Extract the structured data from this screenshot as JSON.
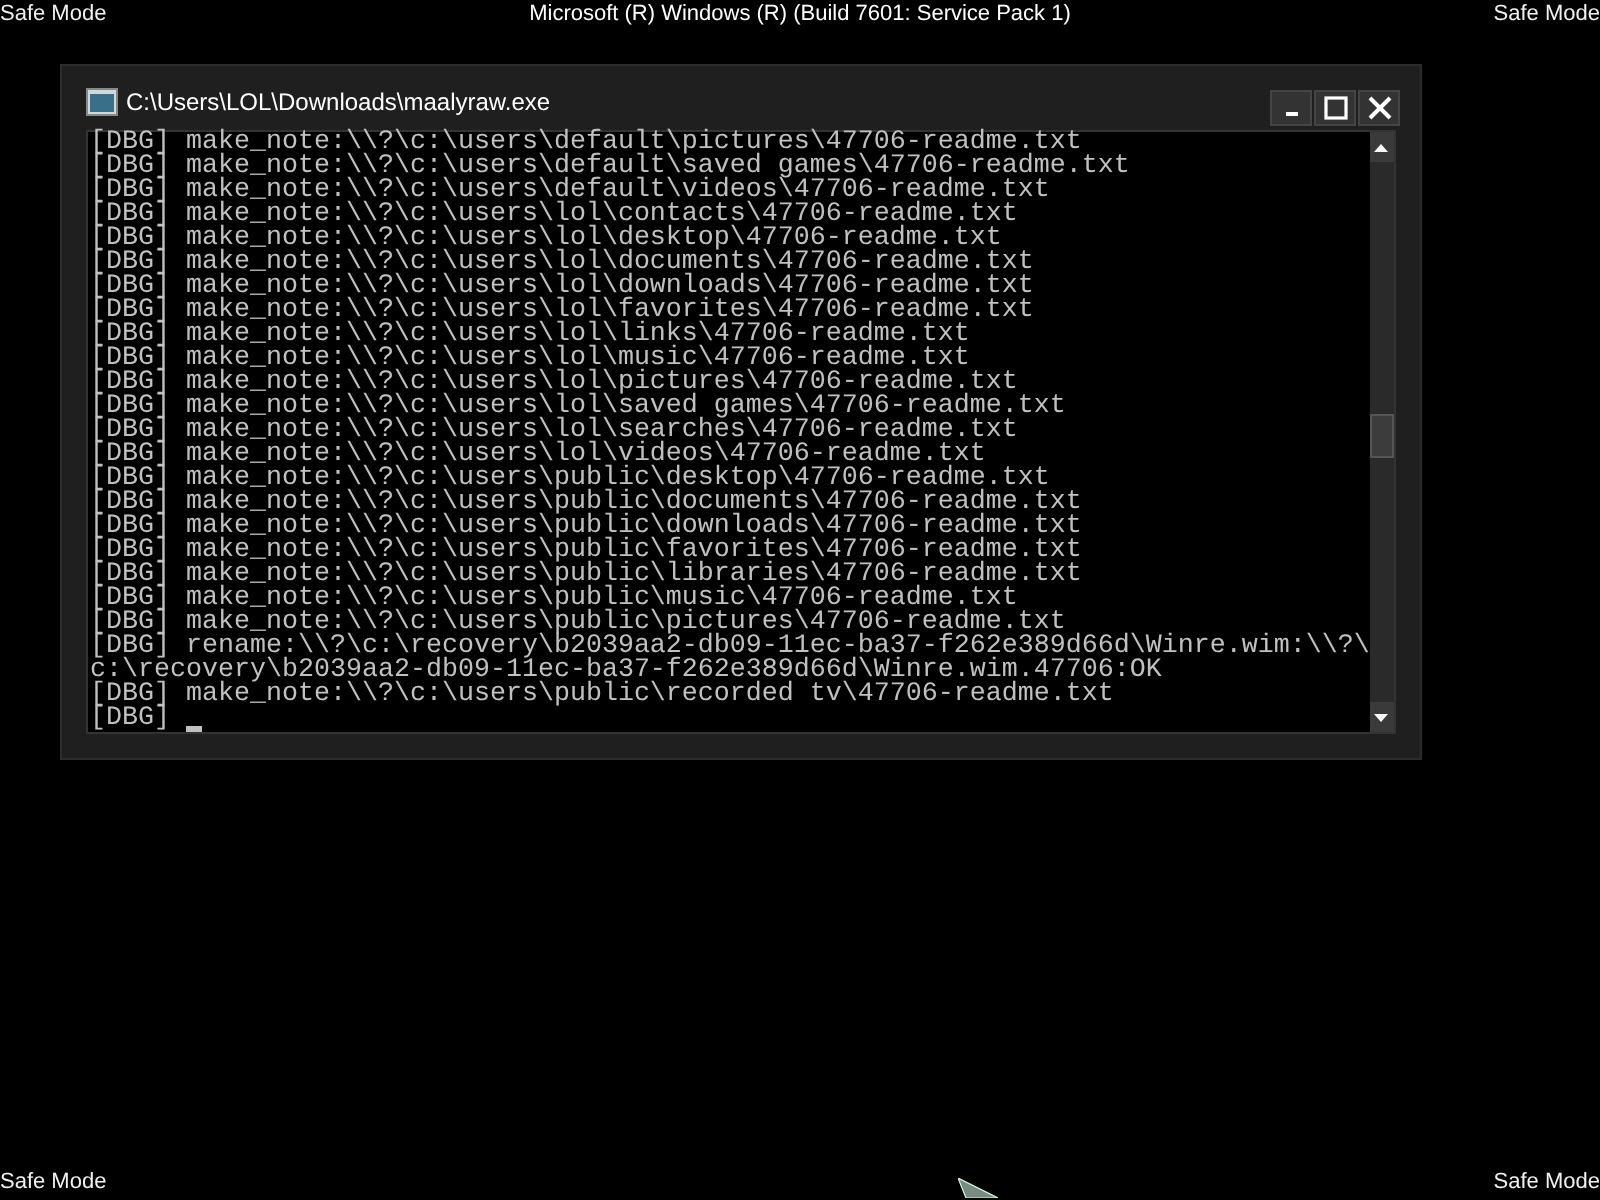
{
  "desktop": {
    "corner_labels": [
      "Safe Mode",
      "Safe Mode",
      "Safe Mode",
      "Safe Mode"
    ],
    "top_center": "Microsoft (R) Windows (R) (Build 7601: Service Pack 1)"
  },
  "window": {
    "title": "C:\\Users\\LOL\\Downloads\\maalyraw.exe",
    "lines": [
      "[DBG] make_note:\\\\?\\c:\\users\\default\\pictures\\47706-readme.txt",
      "[DBG] make_note:\\\\?\\c:\\users\\default\\saved games\\47706-readme.txt",
      "[DBG] make_note:\\\\?\\c:\\users\\default\\videos\\47706-readme.txt",
      "[DBG] make_note:\\\\?\\c:\\users\\lol\\contacts\\47706-readme.txt",
      "[DBG] make_note:\\\\?\\c:\\users\\lol\\desktop\\47706-readme.txt",
      "[DBG] make_note:\\\\?\\c:\\users\\lol\\documents\\47706-readme.txt",
      "[DBG] make_note:\\\\?\\c:\\users\\lol\\downloads\\47706-readme.txt",
      "[DBG] make_note:\\\\?\\c:\\users\\lol\\favorites\\47706-readme.txt",
      "[DBG] make_note:\\\\?\\c:\\users\\lol\\links\\47706-readme.txt",
      "[DBG] make_note:\\\\?\\c:\\users\\lol\\music\\47706-readme.txt",
      "[DBG] make_note:\\\\?\\c:\\users\\lol\\pictures\\47706-readme.txt",
      "[DBG] make_note:\\\\?\\c:\\users\\lol\\saved games\\47706-readme.txt",
      "[DBG] make_note:\\\\?\\c:\\users\\lol\\searches\\47706-readme.txt",
      "[DBG] make_note:\\\\?\\c:\\users\\lol\\videos\\47706-readme.txt",
      "[DBG] make_note:\\\\?\\c:\\users\\public\\desktop\\47706-readme.txt",
      "[DBG] make_note:\\\\?\\c:\\users\\public\\documents\\47706-readme.txt",
      "[DBG] make_note:\\\\?\\c:\\users\\public\\downloads\\47706-readme.txt",
      "[DBG] make_note:\\\\?\\c:\\users\\public\\favorites\\47706-readme.txt",
      "[DBG] make_note:\\\\?\\c:\\users\\public\\libraries\\47706-readme.txt",
      "[DBG] make_note:\\\\?\\c:\\users\\public\\music\\47706-readme.txt",
      "[DBG] make_note:\\\\?\\c:\\users\\public\\pictures\\47706-readme.txt",
      "[DBG] rename:\\\\?\\c:\\recovery\\b2039aa2-db09-11ec-ba37-f262e389d66d\\Winre.wim:\\\\?\\",
      "c:\\recovery\\b2039aa2-db09-11ec-ba37-f262e389d66d\\Winre.wim.47706:OK",
      "[DBG] make_note:\\\\?\\c:\\users\\public\\recorded tv\\47706-readme.txt"
    ],
    "prompt": "[DBG]"
  }
}
